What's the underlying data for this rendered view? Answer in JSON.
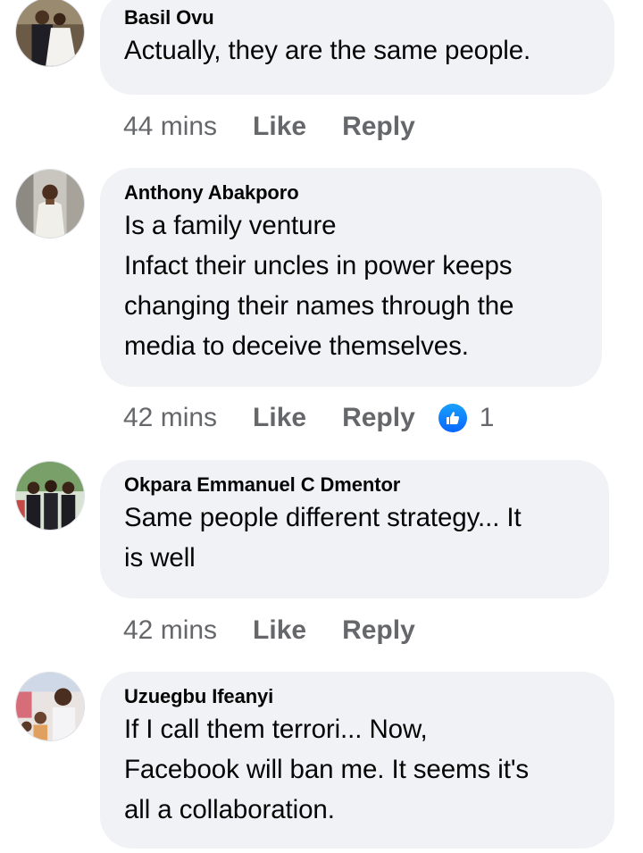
{
  "comments": [
    {
      "author": "Basil Ovu",
      "text": "Actually, they are the same people.",
      "time": "44 mins",
      "like_label": "Like",
      "reply_label": "Reply"
    },
    {
      "author": "Anthony Abakporo",
      "text": "Is a family venture\nInfact their uncles in power keeps\nchanging their names through the\nmedia to deceive themselves.",
      "time": "42 mins",
      "like_label": "Like",
      "reply_label": "Reply",
      "reaction_count": "1",
      "reaction_icon": "thumbs-up-icon"
    },
    {
      "author": "Okpara Emmanuel C Dmentor",
      "text": "Same people different strategy... It\nis well",
      "time": "42 mins",
      "like_label": "Like",
      "reply_label": "Reply"
    },
    {
      "author": "Uzuegbu Ifeanyi",
      "text": "If I call them terrori... Now,\nFacebook will ban me. It seems it's\nall a collaboration."
    }
  ],
  "colors": {
    "bubble": "#f0f2f5",
    "meta_text": "#65676b",
    "like_blue": "#0866ff"
  }
}
